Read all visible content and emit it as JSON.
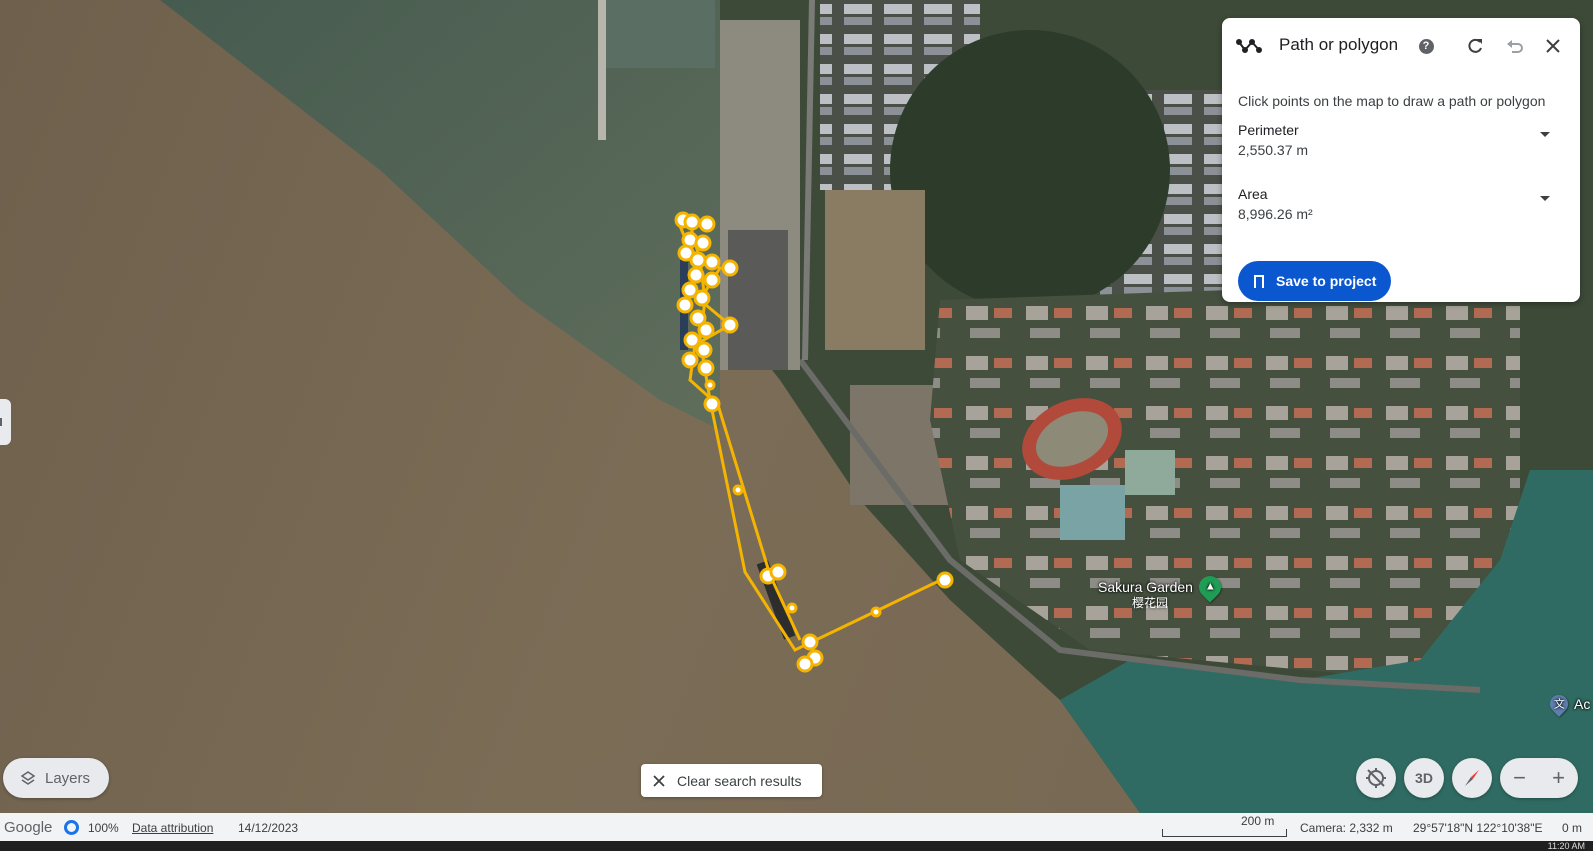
{
  "panel": {
    "title": "Path or polygon",
    "hint": "Click points on the map to draw a path or polygon",
    "perimeter_label": "Perimeter",
    "perimeter_value": "2,550.37 m",
    "area_label": "Area",
    "area_value": "8,996.26 m²",
    "save_label": "Save to project",
    "accent": "#0b57d0"
  },
  "map": {
    "poi_name": "Sakura Garden",
    "poi_sub": "樱花园",
    "poi_color": "#1f9d55",
    "edge_label": "Ac",
    "path_color": "#f5b400",
    "water_color": "#7a6a55"
  },
  "controls": {
    "layers_label": "Layers",
    "clear_label": "Clear search results",
    "three_d_label": "3D"
  },
  "status": {
    "logo": "Google",
    "percent": "100%",
    "attribution": "Data attribution",
    "date": "14/12/2023",
    "scale_label": "200 m",
    "camera": "Camera: 2,332 m",
    "coords": "29°57'18\"N 122°10'38\"E",
    "elevation": "0 m",
    "clock": "11:20 AM"
  },
  "icons": [
    "path-icon",
    "help-icon",
    "redo-icon",
    "undo-icon",
    "close-icon",
    "chevron-down-icon",
    "bookmark-icon",
    "layers-icon",
    "x-icon",
    "location-off-icon",
    "compass-icon",
    "zoom-out-icon",
    "zoom-in-icon",
    "pin-icon"
  ]
}
